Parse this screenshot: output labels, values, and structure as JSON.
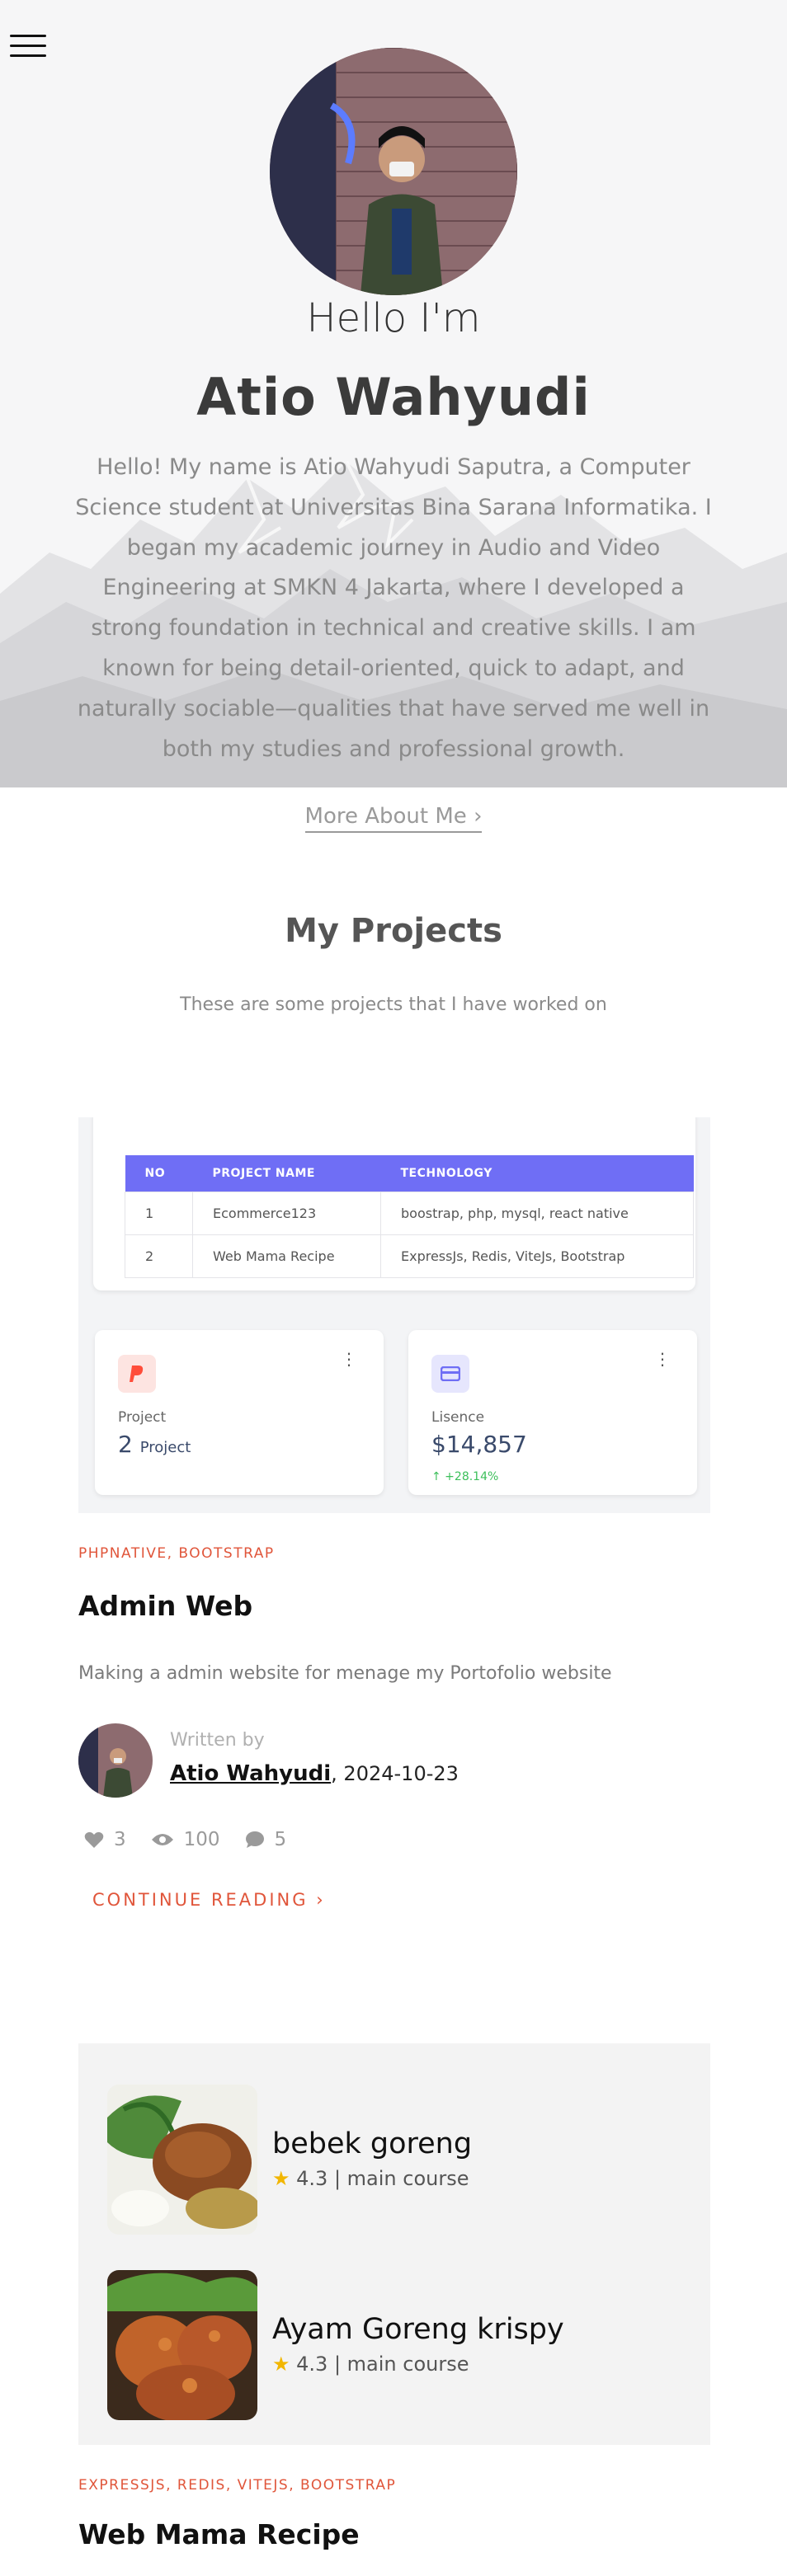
{
  "hero": {
    "greeting": "Hello I'm",
    "name": "Atio Wahyudi",
    "bio": "Hello! My name is Atio Wahyudi Saputra, a Computer Science student at Universitas Bina Sarana Informatika. I began my academic journey in Audio and Video Engineering at SMKN 4 Jakarta, where I developed a strong foundation in technical and creative skills. I am known for being detail-oriented, quick to adapt, and naturally sociable—qualities that have served me well in both my studies and professional growth.",
    "more_link": "More About Me ›"
  },
  "projects": {
    "title": "My Projects",
    "subtitle": "These are some projects that I have worked on"
  },
  "card1": {
    "table": {
      "headers": [
        "NO",
        "PROJECT NAME",
        "TECHNOLOGY"
      ],
      "rows": [
        [
          "1",
          "Ecommerce123",
          "boostrap, php, mysql, react native"
        ],
        [
          "2",
          "Web Mama Recipe",
          "ExpressJs, Redis, ViteJs, Bootstrap"
        ]
      ]
    },
    "stat_project": {
      "label": "Project",
      "value": "2",
      "unit": "Project"
    },
    "stat_lisence": {
      "label": "Lisence",
      "value": "$14,857",
      "change": "↑ +28.14%"
    },
    "tags": "PHPNATIVE, BOOTSTRAP",
    "title": "Admin Web",
    "description": "Making a admin website for menage my Portofolio website",
    "written_by": "Written by",
    "author": "Atio Wahyudi",
    "date": ", 2024-10-23",
    "likes": "3",
    "views": "100",
    "comments": "5",
    "continue": "CONTINUE READING ›"
  },
  "card2": {
    "recipes": [
      {
        "name": "bebek goreng",
        "rating": "4.3",
        "category": "main course"
      },
      {
        "name": "Ayam Goreng krispy",
        "rating": "4.3",
        "category": "main course"
      }
    ],
    "tags": "EXPRESSJS, REDIS, VITEJS, BOOTSTRAP",
    "title": "Web Mama Recipe"
  },
  "colors": {
    "accent": "#e0553a",
    "table_header": "#6f6ef5",
    "positive": "#3cbf5a"
  }
}
